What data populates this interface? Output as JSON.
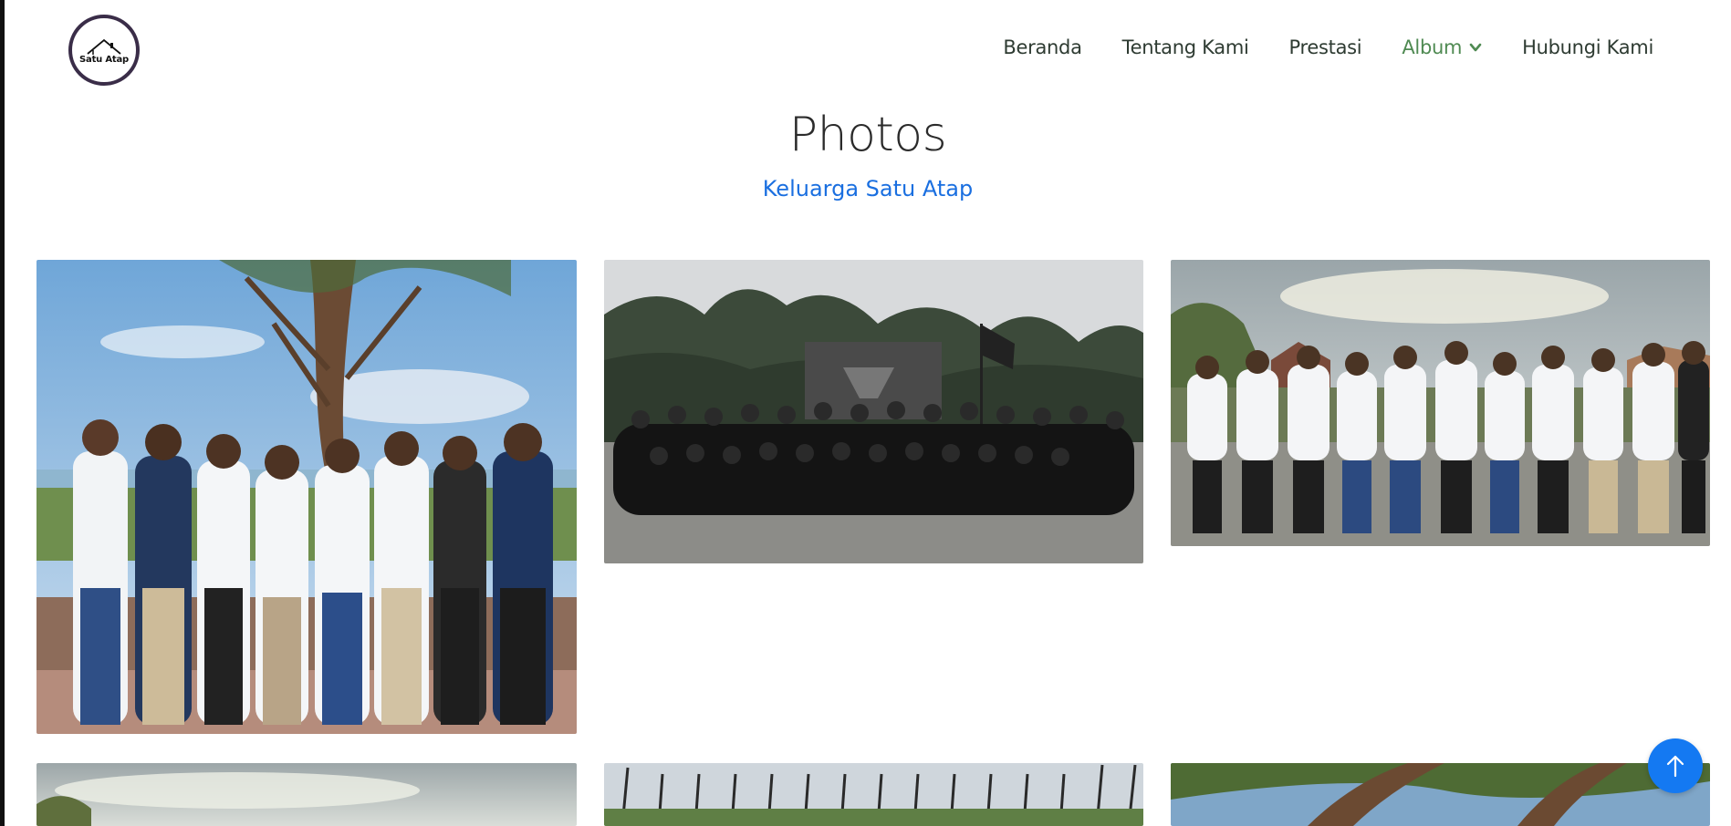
{
  "brand": {
    "logo_text": "Satu Atap",
    "logo_icon": "house-roof-icon"
  },
  "nav": {
    "items": [
      {
        "label": "Beranda"
      },
      {
        "label": "Tentang Kami"
      },
      {
        "label": "Prestasi"
      },
      {
        "label": "Album",
        "active": true,
        "icon": "chevron-down-icon"
      },
      {
        "label": "Hubungi Kami"
      }
    ]
  },
  "section": {
    "title": "Photos",
    "subtitle": "Keluarga Satu Atap"
  },
  "colors": {
    "nav_text": "#2e3b32",
    "nav_active": "#4f8a52",
    "subtitle": "#1a6fe0",
    "back_to_top": "#1479f2"
  },
  "back_to_top": {
    "icon": "arrow-up-icon"
  }
}
